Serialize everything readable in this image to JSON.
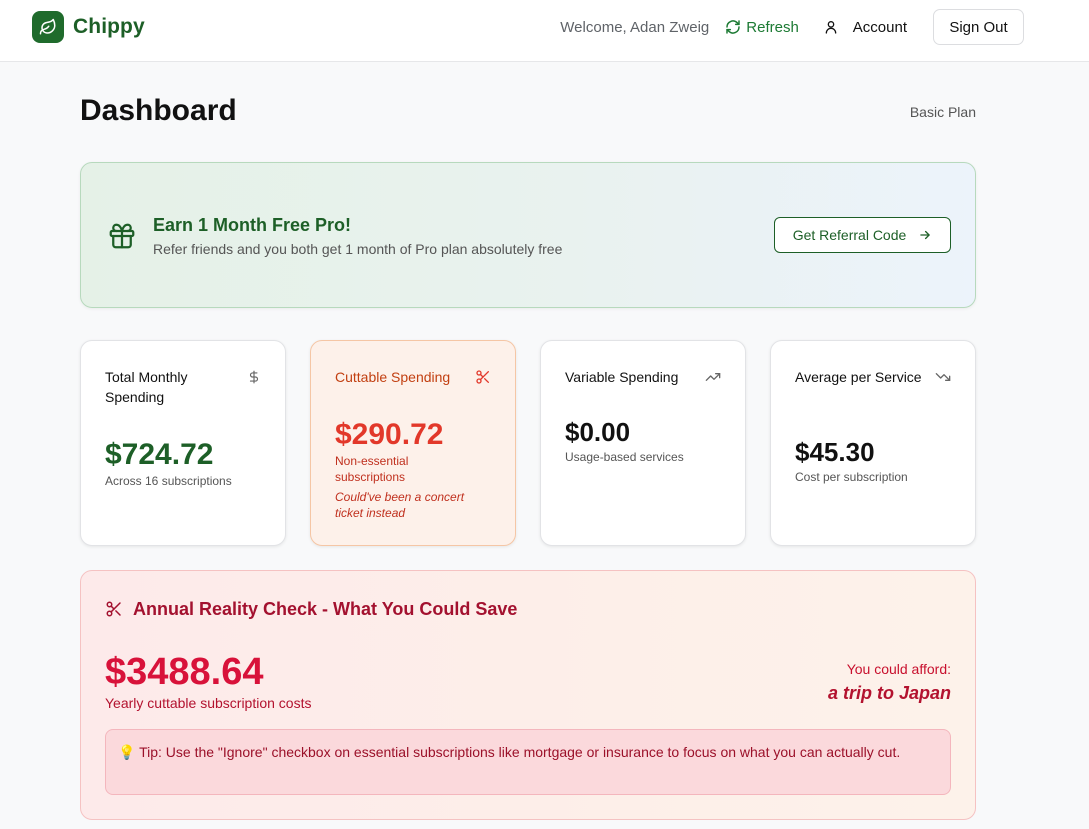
{
  "header": {
    "brand": "Chippy",
    "welcome": "Welcome, Adan Zweig",
    "refresh_label": "Refresh",
    "account_label": "Account",
    "signout_label": "Sign Out"
  },
  "page": {
    "title": "Dashboard",
    "plan": "Basic Plan"
  },
  "referral": {
    "title": "Earn 1 Month Free Pro!",
    "subtitle": "Refer friends and you both get 1 month of Pro plan absolutely free",
    "button_label": "Get Referral Code"
  },
  "stats": [
    {
      "label": "Total Monthly Spending",
      "icon": "dollar-icon",
      "value": "$724.72",
      "sub": "Across 16 subscriptions"
    },
    {
      "label": "Cuttable Spending",
      "icon": "scissors-icon",
      "value": "$290.72",
      "sub": "Non-essential subscriptions",
      "note": "Could've been a concert ticket instead"
    },
    {
      "label": "Variable Spending",
      "icon": "trending-up-icon",
      "value": "$0.00",
      "sub": "Usage-based services"
    },
    {
      "label": "Average per Service",
      "icon": "trending-down-icon",
      "value": "$45.30",
      "sub": "Cost per subscription"
    }
  ],
  "annual": {
    "title": "Annual Reality Check - What You Could Save",
    "value": "$3488.64",
    "sub": "Yearly cuttable subscription costs",
    "afford_label": "You could afford:",
    "afford_item": "a trip to Japan",
    "tip": "💡 Tip: Use the \"Ignore\" checkbox on essential subscriptions like mortgage or insurance to focus on what you can actually cut."
  },
  "colors": {
    "brand": "#1d5f27",
    "danger": "#d8123a",
    "cuttable": "#e2382a"
  }
}
